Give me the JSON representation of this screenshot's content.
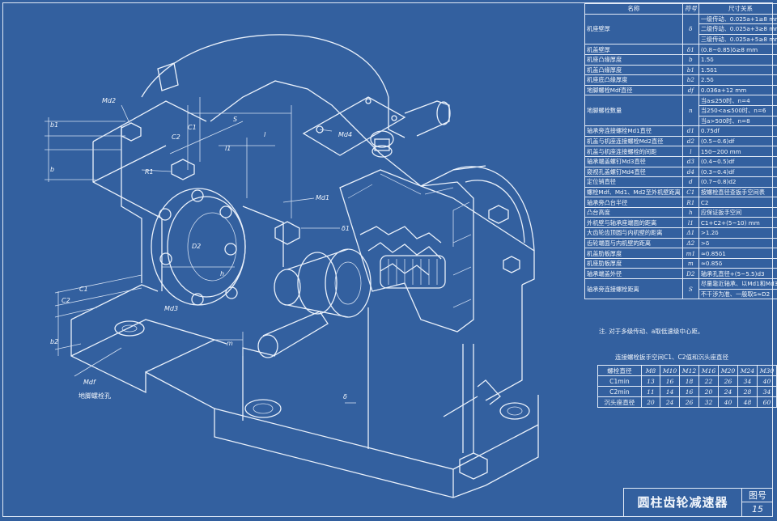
{
  "title": "圆柱齿轮减速器",
  "figure": {
    "label": "图号",
    "number": "15"
  },
  "spec_table": {
    "headers": [
      "名称",
      "符号",
      "尺寸关系"
    ],
    "rows": [
      {
        "name": "机座壁厚",
        "symbol": "δ",
        "relation": "一级传动、0.025a+1≥8 mm",
        "span": 3
      },
      {
        "name": "",
        "symbol": "",
        "relation": "二级传动、0.025a+3≥8 mm",
        "cont": true
      },
      {
        "name": "",
        "symbol": "",
        "relation": "三级传动、0.025a+5≥8 mm",
        "cont": true
      },
      {
        "name": "机盖壁厚",
        "symbol": "δ1",
        "relation": "(0.8~0.85)δ≥8 mm"
      },
      {
        "name": "机座凸缘厚度",
        "symbol": "b",
        "relation": "1.5δ"
      },
      {
        "name": "机盖凸缘厚度",
        "symbol": "b1",
        "relation": "1.5δ1"
      },
      {
        "name": "机座底凸缘厚度",
        "symbol": "b2",
        "relation": "2.5δ"
      },
      {
        "name": "地脚螺栓Mdf直径",
        "symbol": "df",
        "relation": "0.036a+12 mm"
      },
      {
        "name": "地脚螺栓数量",
        "symbol": "n",
        "relation": "当a≤250时、n=4",
        "span": 3
      },
      {
        "name": "",
        "symbol": "",
        "relation": "当250<a≤500时、n=6",
        "cont": true
      },
      {
        "name": "",
        "symbol": "",
        "relation": "当a>500时、n=8",
        "cont": true
      },
      {
        "name": "轴承旁连接螺栓Md1直径",
        "symbol": "d1",
        "relation": "0.75df"
      },
      {
        "name": "机盖与机座连接螺栓Md2直径",
        "symbol": "d2",
        "relation": "(0.5~0.6)df"
      },
      {
        "name": "机盖与机座连接螺栓的间距",
        "symbol": "l",
        "relation": "150~200 mm"
      },
      {
        "name": "轴承端盖螺钉Md3直径",
        "symbol": "d3",
        "relation": "(0.4~0.5)df"
      },
      {
        "name": "窥视孔盖螺钉Md4直径",
        "symbol": "d4",
        "relation": "(0.3~0.4)df"
      },
      {
        "name": "定位销直径",
        "symbol": "d",
        "relation": "(0.7~0.8)d2"
      },
      {
        "name": "螺栓Mdf、Md1、Md2至外机壁距离",
        "symbol": "C1",
        "relation": "按螺栓直径查扳手空间表",
        "span": 2
      },
      {
        "name": "螺栓Mdf、Md1、Md2至凸缘边距离",
        "symbol": "C2",
        "relation": "",
        "cont": true
      },
      {
        "name": "轴承旁凸台半径",
        "symbol": "R1",
        "relation": "C2"
      },
      {
        "name": "凸台高度",
        "symbol": "h",
        "relation": "应保证扳手空间"
      },
      {
        "name": "外机壁与轴承座端面的距离",
        "symbol": "l1",
        "relation": "C1+C2+(5~10) mm"
      },
      {
        "name": "大齿轮齿顶圆与内机壁的距离",
        "symbol": "Δ1",
        "relation": ">1.2δ"
      },
      {
        "name": "齿轮端面与内机壁的距离",
        "symbol": "Δ2",
        "relation": ">δ"
      },
      {
        "name": "机盖肋板厚度",
        "symbol": "m1",
        "relation": "≈0.85δ1"
      },
      {
        "name": "机座肋板厚度",
        "symbol": "m",
        "relation": "≈0.85δ"
      },
      {
        "name": "轴承端盖外径",
        "symbol": "D2",
        "relation": "轴承孔直径+(5~5.5)d3"
      },
      {
        "name": "轴承旁连接螺栓距离",
        "symbol": "S",
        "relation": "尽量靠近轴承、以Md1和Md3",
        "span": 2
      },
      {
        "name": "",
        "symbol": "",
        "relation": "不干涉为准、一般取S≈D2",
        "cont": true
      }
    ]
  },
  "note": "注. 对于多级传动、a取低速级中心距。",
  "bolt_table": {
    "caption": "连接螺栓扳手空间C1、C2值和沉头座直径",
    "header": [
      "螺栓直径",
      "M8",
      "M10",
      "M12",
      "M16",
      "M20",
      "M24",
      "M30"
    ],
    "rows": [
      [
        "C1min",
        "13",
        "16",
        "18",
        "22",
        "26",
        "34",
        "40"
      ],
      [
        "C2min",
        "11",
        "14",
        "16",
        "20",
        "24",
        "28",
        "34"
      ],
      [
        "沉头座直径",
        "20",
        "24",
        "26",
        "32",
        "40",
        "48",
        "60"
      ]
    ]
  },
  "labels": {
    "md2": "Md2",
    "md4": "Md4",
    "md1": "Md1",
    "md3": "Md3",
    "mdf": "Mdf",
    "b": "b",
    "b1": "b1",
    "b2": "b2",
    "c1": "C1",
    "c2": "C2",
    "c1b": "C1",
    "c2b": "C2",
    "s": "S",
    "l": "l",
    "l1": "l1",
    "r1": "R1",
    "d1": "δ1",
    "d2": "D2",
    "h": "h",
    "m": "m",
    "delta": "δ",
    "foundation": "地脚螺栓孔"
  }
}
